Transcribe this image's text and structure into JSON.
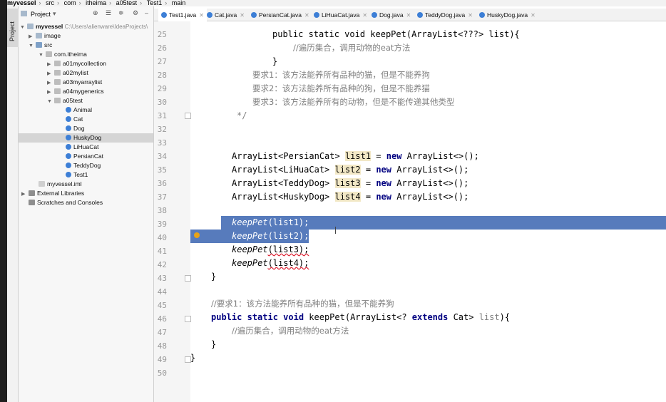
{
  "breadcrumb": {
    "items": [
      "myvessel",
      "src",
      "com",
      "itheima",
      "a05test",
      "Test1",
      "main"
    ]
  },
  "sidebar": {
    "tool_window_label": "Project",
    "header_label": "Project",
    "tree": [
      {
        "label": "myvessel",
        "path": "C:\\Users\\alienware\\IdeaProjects\\",
        "icon": "folder-icon",
        "arrow": "v"
      },
      {
        "label": "image",
        "icon": "folder-icon",
        "arrow": ">"
      },
      {
        "label": "src",
        "icon": "source-folder-icon",
        "arrow": "v"
      },
      {
        "label": "com.itheima",
        "icon": "package-icon",
        "arrow": "v"
      },
      {
        "label": "a01mycollection",
        "icon": "package-icon",
        "arrow": ">"
      },
      {
        "label": "a02mylist",
        "icon": "package-icon",
        "arrow": ">"
      },
      {
        "label": "a03myarraylist",
        "icon": "package-icon",
        "arrow": ">"
      },
      {
        "label": "a04mygenerics",
        "icon": "package-icon",
        "arrow": ">"
      },
      {
        "label": "a05test",
        "icon": "package-icon",
        "arrow": "v"
      },
      {
        "label": "Animal",
        "icon": "class-icon",
        "arrow": ""
      },
      {
        "label": "Cat",
        "icon": "class-icon",
        "arrow": ""
      },
      {
        "label": "Dog",
        "icon": "class-icon",
        "arrow": ""
      },
      {
        "label": "HuskyDog",
        "icon": "class-icon",
        "arrow": ""
      },
      {
        "label": "LiHuaCat",
        "icon": "class-icon",
        "arrow": ""
      },
      {
        "label": "PersianCat",
        "icon": "class-icon",
        "arrow": ""
      },
      {
        "label": "TeddyDog",
        "icon": "class-icon",
        "arrow": ""
      },
      {
        "label": "Test1",
        "icon": "class-icon",
        "arrow": ""
      },
      {
        "label": "myvessel.iml",
        "icon": "file-icon",
        "arrow": ""
      },
      {
        "label": "External Libraries",
        "icon": "library-icon",
        "arrow": ">"
      },
      {
        "label": "Scratches and Consoles",
        "icon": "scratches-icon",
        "arrow": ""
      }
    ],
    "selected": "HuskyDog"
  },
  "tabs": [
    {
      "label": "Test1.java",
      "active": true
    },
    {
      "label": "Cat.java"
    },
    {
      "label": "PersianCat.java"
    },
    {
      "label": "LiHuaCat.java"
    },
    {
      "label": "Dog.java"
    },
    {
      "label": "TeddyDog.java"
    },
    {
      "label": "HuskyDog.java"
    }
  ],
  "editor": {
    "line_numbers": [
      "25",
      "26",
      "27",
      "28",
      "29",
      "30",
      "31",
      "32",
      "33",
      "34",
      "35",
      "36",
      "37",
      "38",
      "39",
      "40",
      "41",
      "42",
      "43",
      "44",
      "45",
      "46",
      "47",
      "48",
      "49",
      "50"
    ],
    "code": {
      "l25a": "public static void keepPet(ArrayList<???> list){",
      "l26a": "//遍历集合，调用动物的eat方法",
      "l27a": "}",
      "l28a": "要求1：该方法能养所有品种的猫，但是不能养狗",
      "l29a": "要求2：该方法能养所有品种的狗，但是不能养猫",
      "l30a": "要求3：该方法能养所有的动物，但是不能传递其他类型",
      "l31a": "*/",
      "l34a": "ArrayList<PersianCat> ",
      "l34b": "list1",
      "l34c": " = ",
      "l34d": "new",
      "l34e": " ArrayList<>();",
      "l35a": "ArrayList<LiHuaCat> ",
      "l35b": "list2",
      "l35c": " = ",
      "l35d": "new",
      "l35e": " ArrayList<>();",
      "l36a": "ArrayList<TeddyDog> ",
      "l36b": "list3",
      "l36c": " = ",
      "l36d": "new",
      "l36e": " ArrayList<>();",
      "l37a": "ArrayList<HuskyDog> ",
      "l37b": "list4",
      "l37c": " = ",
      "l37d": "new",
      "l37e": " ArrayList<>();",
      "l39a": "keepPet",
      "l39b": "(list1);",
      "l40a": "keepPet",
      "l40b": "(list2);",
      "l41a": "keepPet",
      "l41b": "(list3);",
      "l42a": "keepPet",
      "l42b": "(list4);",
      "l43a": "}",
      "l45a": "//要求1：该方法能养所有品种的猫，但是不能养狗",
      "l46a": "public static void",
      "l46b": " keepPet(ArrayList<? ",
      "l46c": "extends",
      "l46d": " Cat> ",
      "l46e": "list",
      "l46f": "){",
      "l47a": "//遍历集合，调用动物的eat方法",
      "l48a": "}",
      "l49a": "}"
    }
  }
}
